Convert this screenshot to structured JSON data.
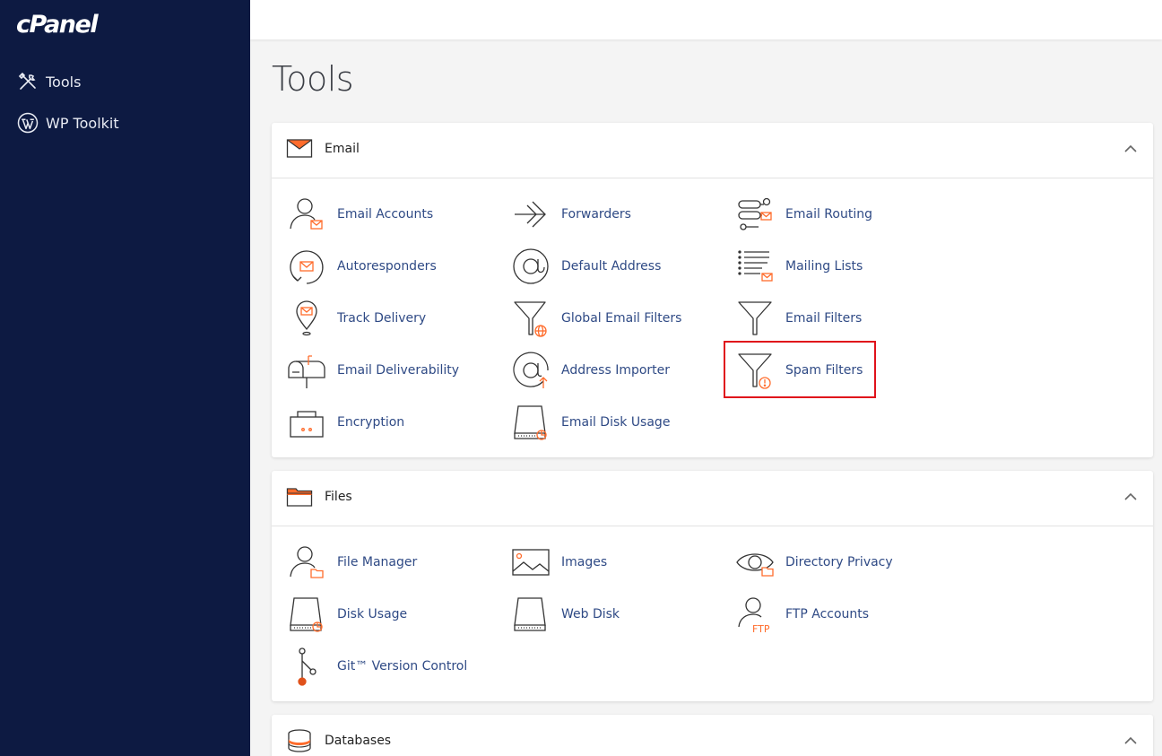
{
  "brand": {
    "logo_text": "cPanel"
  },
  "sidebar": {
    "items": [
      {
        "label": "Tools",
        "icon": "tools-icon"
      },
      {
        "label": "WP Toolkit",
        "icon": "wordpress-icon"
      }
    ]
  },
  "page": {
    "title": "Tools"
  },
  "sections": {
    "email": {
      "title": "Email",
      "items": [
        "Email Accounts",
        "Forwarders",
        "Email Routing",
        "Autoresponders",
        "Default Address",
        "Mailing Lists",
        "Track Delivery",
        "Global Email Filters",
        "Email Filters",
        "Email Deliverability",
        "Address Importer",
        "Spam Filters",
        "Encryption",
        "Email Disk Usage"
      ]
    },
    "files": {
      "title": "Files",
      "items": [
        "File Manager",
        "Images",
        "Directory Privacy",
        "Disk Usage",
        "Web Disk",
        "FTP Accounts",
        "Git™ Version Control"
      ]
    },
    "databases": {
      "title": "Databases"
    }
  },
  "icon_labels": {
    "ftp": "FTP"
  },
  "colors": {
    "sidebar_bg": "#0d1a42",
    "accent_orange": "#ff6c2c",
    "link_blue": "#2f4a85",
    "highlight_red": "#e0121b"
  }
}
